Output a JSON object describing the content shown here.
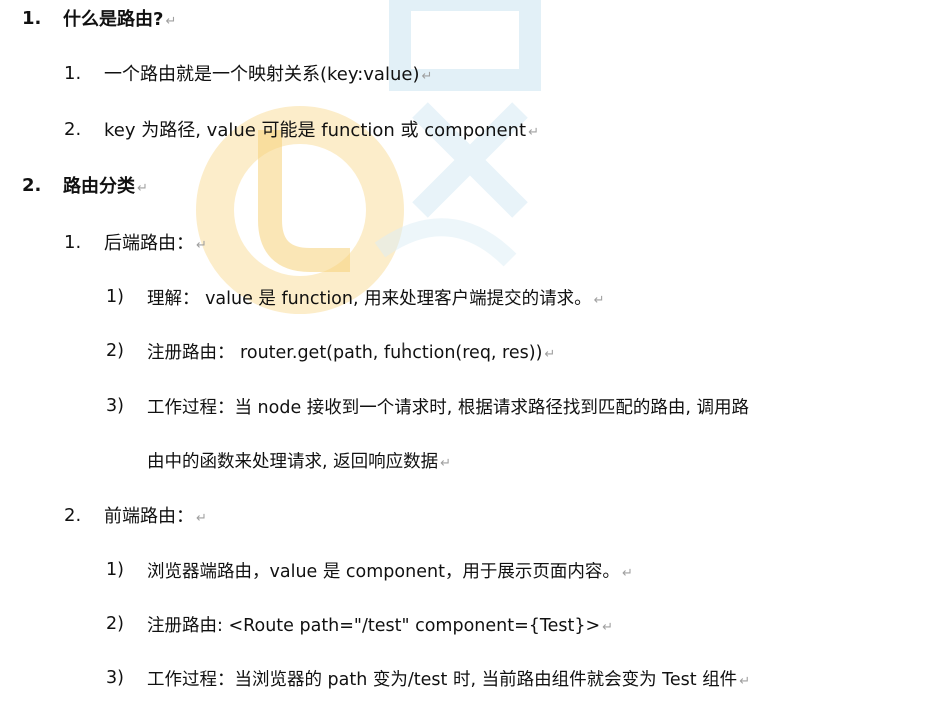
{
  "paragraph_mark": "↵",
  "lines": [
    {
      "num": "1.",
      "text": "什么是路由?"
    },
    {
      "num": "1.",
      "text": "一个路由就是一个映射关系(key:value)"
    },
    {
      "num": "2.",
      "text": "key 为路径, value 可能是 function 或 component"
    },
    {
      "num": "2.",
      "text": "路由分类"
    },
    {
      "num": "1.",
      "text": "后端路由："
    },
    {
      "num": "1)",
      "text": "理解： value 是 function, 用来处理客户端提交的请求。"
    },
    {
      "num": "2)",
      "text": "注册路由： router.get(path, function(req, res))"
    },
    {
      "num": "3)",
      "text": "工作过程：当 node 接收到一个请求时, 根据请求路径找到匹配的路由, 调用路"
    },
    {
      "num": "",
      "text": "由中的函数来处理请求, 返回响应数据"
    },
    {
      "num": "2.",
      "text": "前端路由："
    },
    {
      "num": "1)",
      "text": "浏览器端路由，value 是 component，用于展示页面内容。"
    },
    {
      "num": "2)",
      "text": "注册路由: <Route path=\"/test\" component={Test}>"
    },
    {
      "num": "3)",
      "text": "工作过程：当浏览器的 path 变为/test 时, 当前路由组件就会变为 Test 组件"
    }
  ]
}
